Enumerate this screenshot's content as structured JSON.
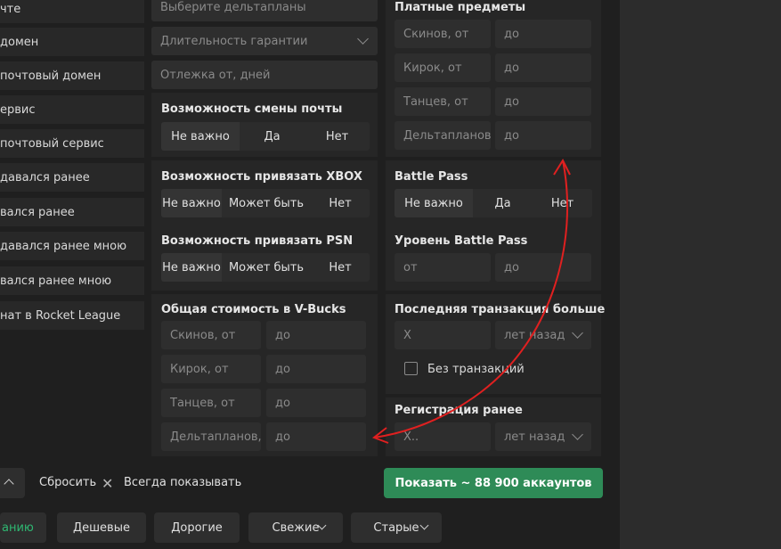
{
  "left_list": [
    "чте",
    "домен",
    "почтовый домен",
    "ервис",
    "почтовый сервис",
    "давался ранее",
    "вался ранее",
    "давался ранее мною",
    "вался ранее мною",
    "нат в Rocket League"
  ],
  "middle": {
    "select_gliders": "Выберите дельтапланы",
    "warranty": "Длительность гарантии",
    "rest_days": "Отлежка от, дней",
    "email_change": {
      "title": "Возможность смены почты",
      "options": [
        "Не важно",
        "Да",
        "Нет"
      ]
    },
    "xbox": {
      "title": "Возможность привязать XBOX",
      "options": [
        "Не важно",
        "Может быть",
        "Нет"
      ]
    },
    "psn": {
      "title": "Возможность привязать PSN",
      "options": [
        "Не важно",
        "Может быть",
        "Нет"
      ]
    },
    "vbucks": {
      "title": "Общая стоимость в V-Bucks",
      "rows": [
        {
          "from": "Скинов, от",
          "to": "до"
        },
        {
          "from": "Кирок, от",
          "to": "до"
        },
        {
          "from": "Танцев, от",
          "to": "до"
        },
        {
          "from": "Дельтапланов,",
          "to": "до"
        }
      ]
    }
  },
  "right": {
    "paid": {
      "title": "Платные предметы",
      "rows": [
        {
          "from": "Скинов, от",
          "to": "до"
        },
        {
          "from": "Кирок, от",
          "to": "до"
        },
        {
          "from": "Танцев, от",
          "to": "до"
        },
        {
          "from": "Дельтапланов",
          "to": "до"
        }
      ]
    },
    "battle_pass": {
      "title": "Battle Pass",
      "options": [
        "Не важно",
        "Да",
        "Нет"
      ]
    },
    "bp_level": {
      "title": "Уровень Battle Pass",
      "from": "от",
      "to": "до"
    },
    "last_tx": {
      "title": "Последняя транзакция больше",
      "value": "X",
      "unit": "лет назад",
      "checkbox": "Без транзакций"
    },
    "registration": {
      "title": "Регистрация ранее",
      "value": "X..",
      "unit": "лет назад"
    }
  },
  "bottom": {
    "reset": "Сбросить",
    "always_show": "Всегда показывать",
    "show_button": "Показать ~ 88 900 аккаунтов",
    "sort": [
      "анию",
      "Дешевые",
      "Дорогие",
      "Свежие",
      "Старые"
    ]
  },
  "colors": {
    "accent": "#2e8b57",
    "annotation": "#e02020"
  }
}
